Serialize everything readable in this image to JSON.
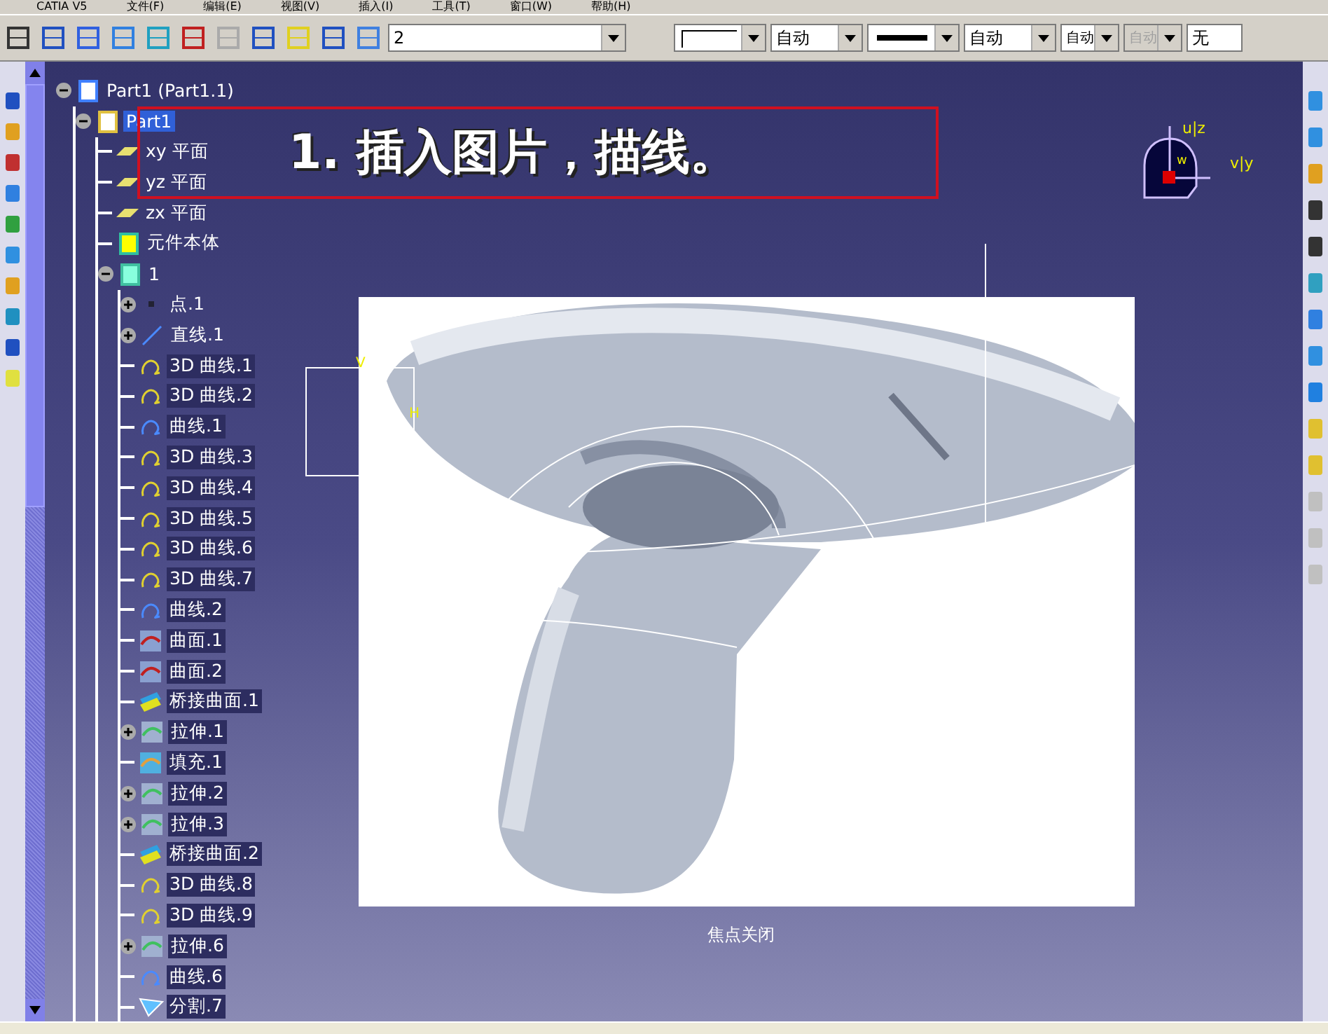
{
  "menu": [
    "CATIA V5",
    "文件(F)",
    "编辑(E)",
    "视图(V)",
    "插入(I)",
    "工具(T)",
    "窗口(W)",
    "帮助(H)"
  ],
  "toolbar": {
    "layer_value": "2",
    "color_value": "自动",
    "weight_value": "自动",
    "style_value": "自动",
    "disabled_value": "自动",
    "material_value": "无"
  },
  "tree": [
    {
      "label": "Part1 (Part1.1)",
      "kind": "product",
      "expanded": true,
      "highlighted": false,
      "selected": false,
      "children": [
        {
          "label": "Part1",
          "kind": "part",
          "expanded": true,
          "highlighted": false,
          "selected": true,
          "children": [
            {
              "label": "xy 平面",
              "kind": "plane",
              "highlighted": false,
              "selected": false
            },
            {
              "label": "yz 平面",
              "kind": "plane",
              "highlighted": false,
              "selected": false
            },
            {
              "label": "zx 平面",
              "kind": "plane",
              "highlighted": false,
              "selected": false
            },
            {
              "label": "元件本体",
              "kind": "body",
              "highlighted": false,
              "selected": false
            },
            {
              "label": "1",
              "kind": "set",
              "expanded": true,
              "highlighted": false,
              "selected": false,
              "children": [
                {
                  "label": "点.1",
                  "kind": "point",
                  "expanded": false,
                  "highlighted": false,
                  "selected": false
                },
                {
                  "label": "直线.1",
                  "kind": "line",
                  "expanded": false,
                  "highlighted": false,
                  "selected": false
                },
                {
                  "label": "3D 曲线.1",
                  "kind": "curve3d",
                  "highlighted": true,
                  "selected": false
                },
                {
                  "label": "3D 曲线.2",
                  "kind": "curve3d",
                  "highlighted": true,
                  "selected": false
                },
                {
                  "label": "曲线.1",
                  "kind": "curve",
                  "highlighted": true,
                  "selected": false
                },
                {
                  "label": "3D 曲线.3",
                  "kind": "curve3d",
                  "highlighted": true,
                  "selected": false
                },
                {
                  "label": "3D 曲线.4",
                  "kind": "curve3d",
                  "highlighted": true,
                  "selected": false
                },
                {
                  "label": "3D 曲线.5",
                  "kind": "curve3d",
                  "highlighted": true,
                  "selected": false
                },
                {
                  "label": "3D 曲线.6",
                  "kind": "curve3d",
                  "highlighted": true,
                  "selected": false
                },
                {
                  "label": "3D 曲线.7",
                  "kind": "curve3d",
                  "highlighted": true,
                  "selected": false
                },
                {
                  "label": "曲线.2",
                  "kind": "curve",
                  "highlighted": true,
                  "selected": false
                },
                {
                  "label": "曲面.1",
                  "kind": "surface",
                  "highlighted": true,
                  "selected": false
                },
                {
                  "label": "曲面.2",
                  "kind": "surface",
                  "highlighted": true,
                  "selected": false
                },
                {
                  "label": "桥接曲面.1",
                  "kind": "blend",
                  "highlighted": true,
                  "selected": false
                },
                {
                  "label": "拉伸.1",
                  "kind": "extrude",
                  "expanded": false,
                  "highlighted": true,
                  "selected": false
                },
                {
                  "label": "填充.1",
                  "kind": "fill",
                  "highlighted": true,
                  "selected": false
                },
                {
                  "label": "拉伸.2",
                  "kind": "extrude",
                  "expanded": false,
                  "highlighted": true,
                  "selected": false
                },
                {
                  "label": "拉伸.3",
                  "kind": "extrude",
                  "expanded": false,
                  "highlighted": true,
                  "selected": false
                },
                {
                  "label": "桥接曲面.2",
                  "kind": "blend",
                  "highlighted": true,
                  "selected": false
                },
                {
                  "label": "3D 曲线.8",
                  "kind": "curve3d",
                  "highlighted": true,
                  "selected": false
                },
                {
                  "label": "3D 曲线.9",
                  "kind": "curve3d",
                  "highlighted": true,
                  "selected": false
                },
                {
                  "label": "拉伸.6",
                  "kind": "extrude",
                  "expanded": false,
                  "highlighted": true,
                  "selected": false
                },
                {
                  "label": "曲线.6",
                  "kind": "curve",
                  "highlighted": true,
                  "selected": false
                },
                {
                  "label": "分割.7",
                  "kind": "split",
                  "highlighted": true,
                  "selected": false
                }
              ]
            }
          ]
        }
      ]
    }
  ],
  "annotation": "1. 插入图片，描线。",
  "sketch_label_v": "V",
  "sketch_label_h": "H",
  "compass": {
    "u_label": "u|z",
    "v_label": "v|y",
    "w_label": "w"
  },
  "focus_label": "焦点关闭"
}
